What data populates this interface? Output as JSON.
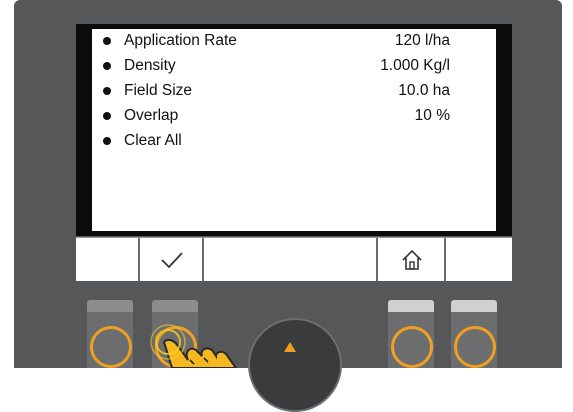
{
  "menu": {
    "items": [
      {
        "label": "Application Rate",
        "value": "120 l/ha"
      },
      {
        "label": "Density",
        "value": "1.000 Kg/l"
      },
      {
        "label": "Field Size",
        "value": "10.0 ha"
      },
      {
        "label": "Overlap",
        "value": "10 %"
      },
      {
        "label": "Clear All",
        "value": ""
      }
    ]
  },
  "softkeys": {
    "icons": [
      "",
      "checkmark-icon",
      "",
      "home-icon",
      ""
    ]
  },
  "colors": {
    "accent": "#f0a020",
    "housing": "#555759",
    "screen": "#ffffff"
  }
}
